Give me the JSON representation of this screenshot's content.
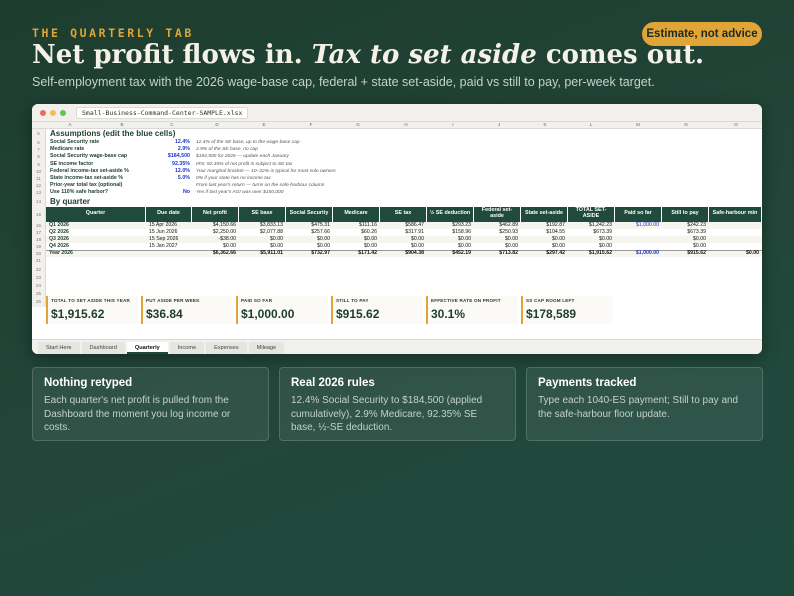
{
  "eyebrow": "THE QUARTERLY TAB",
  "badge": "Estimate, not advice",
  "headline": {
    "part1": "Net profit flows in.",
    "italic": "Tax to set aside",
    "part2": "comes out."
  },
  "subhead": "Self-employment tax with the 2026 wage-base cap, federal + state set-aside, paid vs still to pay, per-week target.",
  "window": {
    "filename": "Small-Business-Command-Center-SAMPLE.xlsx",
    "columns": [
      "A",
      "B",
      "C",
      "D",
      "E",
      "F",
      "G",
      "H",
      "I",
      "J",
      "K",
      "L",
      "M",
      "N",
      "O"
    ],
    "section1": {
      "rownum": "5",
      "title": "Assumptions (edit the blue cells)"
    },
    "assumptions": [
      {
        "rownum": "6",
        "label": "Social Security rate",
        "value": "12.4%",
        "note": "12.4% of the SE base, up to the wage-base cap"
      },
      {
        "rownum": "7",
        "label": "Medicare rate",
        "value": "2.9%",
        "note": "2.9% of the SE base, no cap"
      },
      {
        "rownum": "8",
        "label": "Social Security wage-base cap",
        "value": "$184,500",
        "note": "$184,500 for 2026 — update each January"
      },
      {
        "rownum": "9",
        "label": "SE income factor",
        "value": "92.35%",
        "note": "IRS: 92.35% of net profit is subject to SE tax"
      },
      {
        "rownum": "10",
        "label": "Federal income-tax set-aside %",
        "value": "12.0%",
        "note": "Your marginal bracket — 10–22% is typical for most solo owners"
      },
      {
        "rownum": "11",
        "label": "State income-tax set-aside %",
        "value": "5.0%",
        "note": "0% if your state has no income tax"
      },
      {
        "rownum": "12",
        "label": "Prior-year total tax (optional)",
        "value": "",
        "note": "From last year's return — turns on the safe-harbour column"
      },
      {
        "rownum": "13",
        "label": "Use 110% safe harbor?",
        "value": "No",
        "note": "Yes if last year's AGI was over $150,000"
      }
    ],
    "section2": {
      "rownum": "14",
      "title": "By quarter"
    },
    "table_headers": [
      "Quarter",
      "Due date",
      "Net profit",
      "SE base",
      "Social Security",
      "Medicare",
      "SE tax",
      "½ SE deduction",
      "Federal set-aside",
      "State set-aside",
      "TOTAL SET-ASIDE",
      "Paid so far",
      "Still to pay",
      "Safe-harbour min"
    ],
    "table_rows": [
      {
        "rownum": "16",
        "cells": [
          "Q1 2026",
          "15 Apr 2026",
          "$4,150.66",
          "$3,833.13",
          "$475.31",
          "$111.16",
          "$586.47",
          "$293.23",
          "$462.89",
          "$192.87",
          "$1,242.23",
          "$1,000.00",
          "$242.23",
          ""
        ]
      },
      {
        "rownum": "17",
        "cells": [
          "Q2 2026",
          "15 Jun 2026",
          "$2,250.00",
          "$2,077.88",
          "$257.66",
          "$60.26",
          "$317.91",
          "$158.96",
          "$250.93",
          "$104.55",
          "$673.39",
          "",
          "$673.39",
          ""
        ]
      },
      {
        "rownum": "18",
        "cells": [
          "Q3 2026",
          "15 Sep 2026",
          "-$38.00",
          "$0.00",
          "$0.00",
          "$0.00",
          "$0.00",
          "$0.00",
          "$0.00",
          "$0.00",
          "$0.00",
          "",
          "$0.00",
          ""
        ]
      },
      {
        "rownum": "19",
        "cells": [
          "Q4 2026",
          "15 Jan 2027",
          "$0.00",
          "$0.00",
          "$0.00",
          "$0.00",
          "$0.00",
          "$0.00",
          "$0.00",
          "$0.00",
          "$0.00",
          "",
          "$0.00",
          ""
        ]
      },
      {
        "rownum": "20",
        "cells": [
          "Year 2026",
          "",
          "$6,362.66",
          "$5,911.01",
          "$732.97",
          "$171.42",
          "$904.38",
          "$452.19",
          "$713.82",
          "$297.42",
          "$1,915.62",
          "$1,000.00",
          "$915.62",
          "$0.00"
        ]
      }
    ],
    "extra_rownums": [
      "21",
      "22",
      "23",
      "24",
      "25",
      "26"
    ],
    "kpis": [
      {
        "label": "TOTAL TO SET ASIDE THIS YEAR",
        "value": "$1,915.62"
      },
      {
        "label": "PUT ASIDE PER WEEK",
        "value": "$36.84"
      },
      {
        "label": "PAID SO FAR",
        "value": "$1,000.00"
      },
      {
        "label": "STILL TO PAY",
        "value": "$915.62"
      },
      {
        "label": "EFFECTIVE RATE ON PROFIT",
        "value": "30.1%"
      },
      {
        "label": "SS CAP ROOM LEFT",
        "value": "$178,589"
      }
    ],
    "tabs": [
      "Start Here",
      "Dashboard",
      "Quarterly",
      "Income",
      "Expenses",
      "Mileage"
    ],
    "active_tab": "Quarterly"
  },
  "cards": [
    {
      "title": "Nothing retyped",
      "body": "Each quarter's net profit is pulled from the Dashboard the moment you log income or costs."
    },
    {
      "title": "Real 2026 rules",
      "body": "12.4% Social Security to $184,500 (applied cumulatively), 2.9% Medicare, 92.35% SE base, ½-SE deduction."
    },
    {
      "title": "Payments tracked",
      "body": "Type each 1040-ES payment; Still to pay and the safe-harbour floor update."
    }
  ],
  "colors": {
    "accent": "#e0a437",
    "bg": "#1d3d2e",
    "table_header": "#1f4a3c",
    "input_blue": "#1a36c9"
  }
}
